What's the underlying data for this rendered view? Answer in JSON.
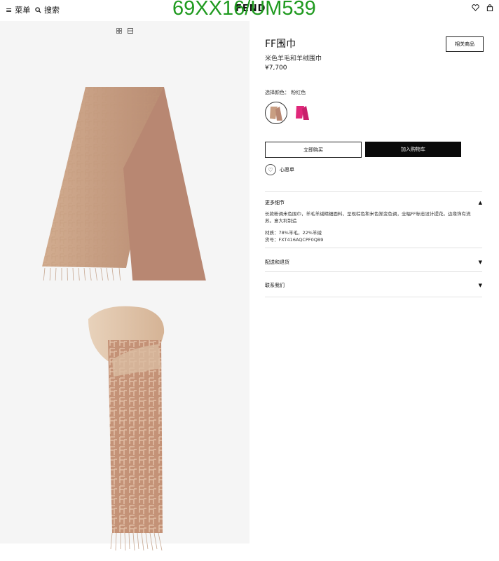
{
  "header": {
    "menu_label": "菜单",
    "search_label": "搜索",
    "brand": "FENDI",
    "watermark": "69XX16/UM539"
  },
  "product": {
    "title": "FF围巾",
    "subtitle": "米色羊毛和羊绒围巾",
    "price": "¥7,700",
    "related_label": "相关商品",
    "color_label": "选择颜色：  粉红色",
    "buy_now_label": "立即购买",
    "add_to_cart_label": "加入购物车",
    "wishlist_label": "心愿单"
  },
  "details": {
    "title": "更多细节",
    "description": "长款粉调米色围巾，羊毛羊绒精细面料，呈现棕色和米色渐变色调，全幅FF标志设计提花。边缘饰有流苏。意大利制造",
    "material": "材质：78%羊毛，22%羊绒",
    "code": "货号：FXT416AQCPF0QB9"
  },
  "accordions": [
    {
      "label": "配送和退货"
    },
    {
      "label": "联系我们"
    }
  ],
  "colors": {
    "scarf_beige": "#c89e82",
    "scarf_pink": "#e0277a",
    "gallery_bg": "#f5f5f5",
    "watermark": "#1f9a1f"
  }
}
